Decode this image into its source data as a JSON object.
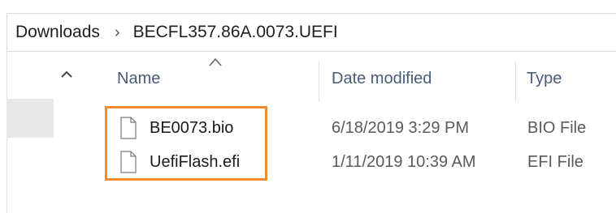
{
  "address_bar": {
    "crumbs": [
      "Downloads",
      "BECFL357.86A.0073.UEFI"
    ],
    "separator": "›"
  },
  "columns": {
    "name": "Name",
    "date_modified": "Date modified",
    "type": "Type",
    "sorted_by": "name",
    "sort_direction": "ascending"
  },
  "files": [
    {
      "name": "BE0073.bio",
      "date_modified": "6/18/2019 3:29 PM",
      "type": "BIO File",
      "icon": "file-icon"
    },
    {
      "name": "UefiFlash.efi",
      "date_modified": "1/11/2019 10:39 AM",
      "type": "EFI File",
      "icon": "file-icon"
    }
  ],
  "highlight": {
    "color": "#f28b2d",
    "targets": [
      "BE0073.bio",
      "UefiFlash.efi"
    ]
  },
  "colors": {
    "header_text": "#4a5c7a",
    "selected_nav": "#e8e8e8"
  }
}
